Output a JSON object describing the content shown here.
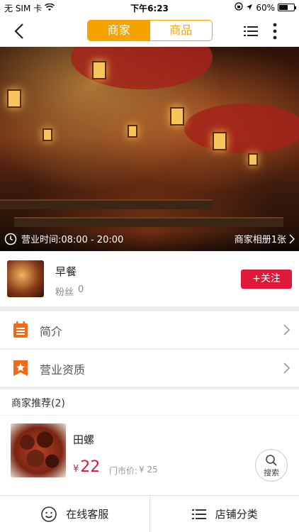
{
  "status_bar": {
    "carrier": "无 SIM 卡",
    "time": "下午6:23",
    "battery": "60%",
    "battery_level": 0.6
  },
  "nav": {
    "tabs": [
      {
        "label": "商家",
        "active": true
      },
      {
        "label": "商品",
        "active": false
      }
    ],
    "accent_color": "#f5a300"
  },
  "banner": {
    "hours_label": "营业时间:08:00 - 20:00",
    "album_label": "商家相册1张"
  },
  "merchant": {
    "name": "早餐",
    "fans_label": "粉丝",
    "fans_count": "0",
    "follow_label": "+关注",
    "follow_color": "#e0193a"
  },
  "rows": [
    {
      "label": "简介",
      "icon": "document-icon"
    },
    {
      "label": "营业资质",
      "icon": "star-badge-icon"
    }
  ],
  "recommend": {
    "title": "商家推荐(2)",
    "items": [
      {
        "name": "田螺",
        "currency": "¥",
        "price": "22",
        "market_price_label": "门市价:",
        "market_price": "¥ 25"
      }
    ]
  },
  "search_fab": {
    "label": "搜索"
  },
  "bottom_bar": {
    "service_label": "在线客服",
    "category_label": "店铺分类"
  }
}
